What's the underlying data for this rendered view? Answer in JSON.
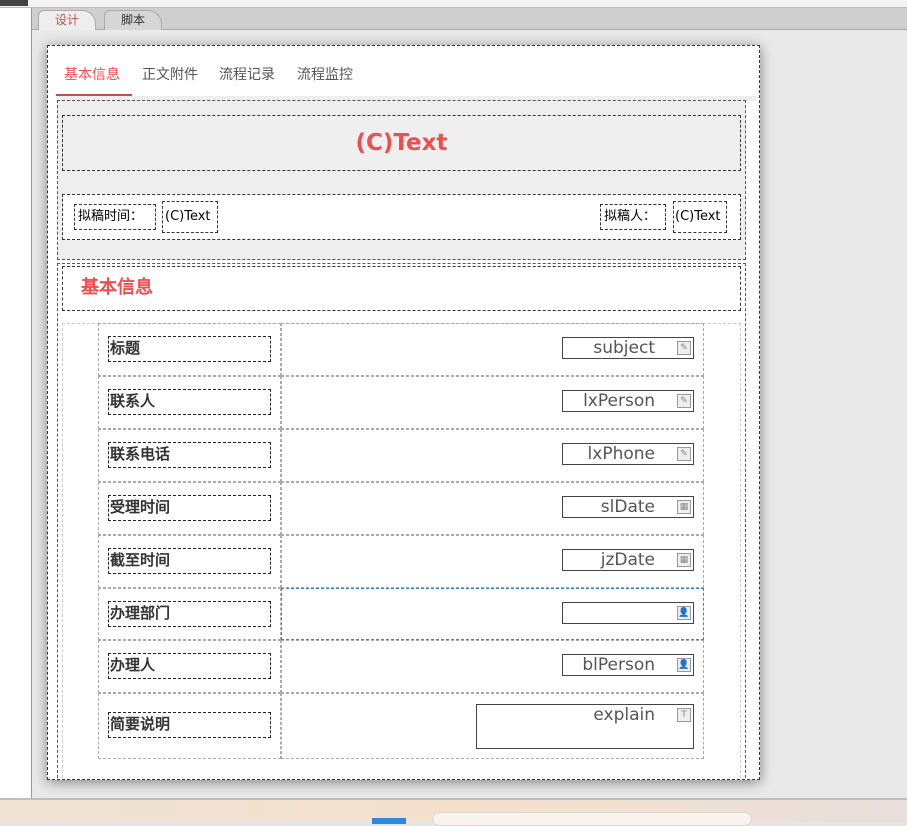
{
  "editor_tabs": [
    {
      "label": "设计",
      "active": true
    },
    {
      "label": "脚本",
      "active": false
    }
  ],
  "form_tabs": [
    {
      "label": "基本信息",
      "active": true
    },
    {
      "label": "正文附件"
    },
    {
      "label": "流程记录"
    },
    {
      "label": "流程监控"
    }
  ],
  "title": "(C)Text",
  "meta": {
    "draft_time_label": "拟稿时间：",
    "draft_time_value": "(C)Text",
    "drafter_label": "拟稿人：",
    "drafter_value": "(C)Text"
  },
  "section_title": "基本信息",
  "fields": [
    {
      "label": "标题",
      "value": "subject",
      "icon": "edit-icon"
    },
    {
      "label": "联系人",
      "value": "lxPerson",
      "icon": "edit-icon"
    },
    {
      "label": "联系电话",
      "value": "lxPhone",
      "icon": "edit-icon"
    },
    {
      "label": "受理时间",
      "value": "slDate",
      "icon": "calendar-icon"
    },
    {
      "label": "截至时间",
      "value": "jzDate",
      "icon": "calendar-icon"
    },
    {
      "label": "办理部门",
      "value": "",
      "icon": "person-icon"
    },
    {
      "label": "办理人",
      "value": "blPerson",
      "icon": "person-icon"
    },
    {
      "label": "简要说明",
      "value": "explain",
      "icon": "textarea-icon"
    }
  ],
  "colors": {
    "accent": "#f24d4d",
    "tab_active": "#c0504d"
  }
}
